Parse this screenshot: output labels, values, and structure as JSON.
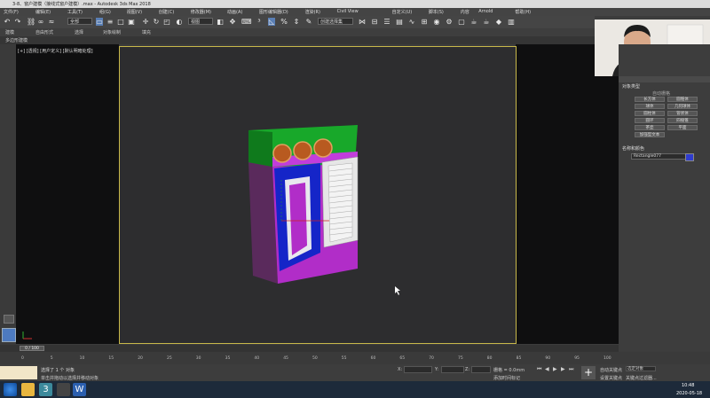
{
  "title": "3-8、窗户建模（接线式窗户建模）.max - Autodesk 3ds Max 2018",
  "menu": [
    "文件(F)",
    "编辑(E)",
    "工具(T)",
    "组(G)",
    "视图(V)",
    "创建(C)",
    "修改器(M)",
    "动画(A)",
    "图形编辑器(D)",
    "渲染(R)",
    "Civil View",
    "自定义(U)",
    "脚本(S)",
    "内容",
    "Arnold",
    "帮助(H)"
  ],
  "toolbar": {
    "filter": "全部",
    "view_dropdown": "视图",
    "selection_set": "创建选择集"
  },
  "ribbon": [
    "建模",
    "自由形式",
    "选择",
    "对象绘制",
    "填充"
  ],
  "ribbon_sub": "多边形建模",
  "viewport_label": "[+] [透视] [用户定义] [默认明暗处理]",
  "panel": {
    "section1": "对象类型",
    "autogrid": "自动栅格",
    "buttons": [
      "长方体",
      "圆锥体",
      "球体",
      "几何球体",
      "圆柱体",
      "管状体",
      "圆环",
      "四棱锥",
      "茶壶",
      "平面",
      "加强型文本"
    ],
    "section2": "名称和颜色",
    "object_name": "Rectangle077",
    "object_color": "#2f3ccf"
  },
  "timeslider": {
    "frame": "0 / 100"
  },
  "timeline_ticks": [
    "0",
    "5",
    "10",
    "15",
    "20",
    "25",
    "30",
    "35",
    "40",
    "45",
    "50",
    "55",
    "60",
    "65",
    "70",
    "75",
    "80",
    "85",
    "90",
    "95",
    "100"
  ],
  "status": {
    "selected": "选择了 1 个 对象",
    "hint": "单击并拖动以选择并移动对象",
    "x_label": "X:",
    "y_label": "Y:",
    "z_label": "Z:",
    "grid": "栅格 = 0.0mm",
    "add_time_tag": "添加时间标记",
    "auto_key": "自动关键点",
    "selected_obj": "选定对象",
    "set_key": "设置关键点",
    "key_filter": "关键点过滤器..."
  },
  "taskbar": {
    "time": "10:48",
    "date": "2020-05-18"
  },
  "webcam_label": "instructor webcam"
}
